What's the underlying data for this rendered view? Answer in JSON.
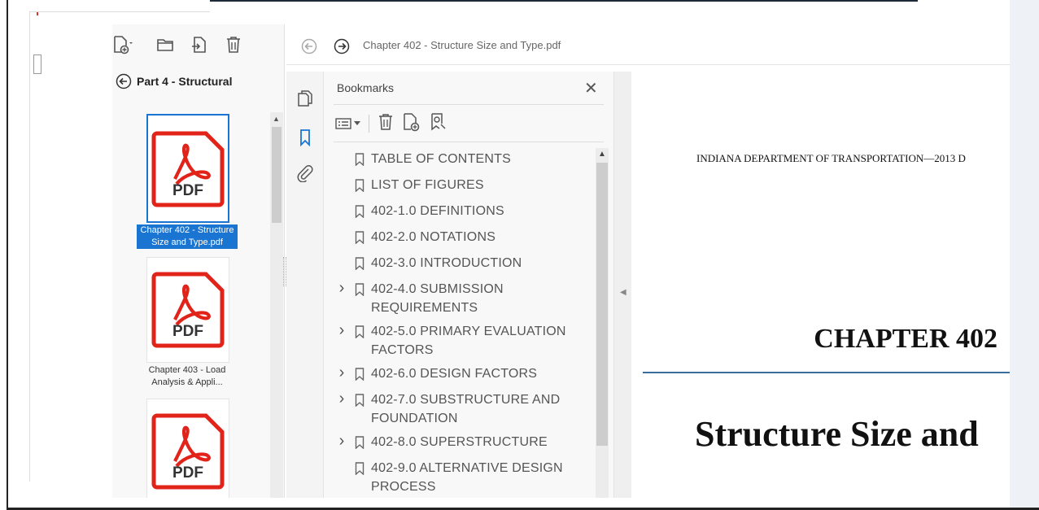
{
  "file_panel": {
    "back_label": "Part 4 - Structural",
    "files": [
      {
        "name": "Chapter 402 - Structure Size and Type.pdf",
        "icon_text": "PDF",
        "selected": true
      },
      {
        "name": "Chapter 403 - Load Analysis & Appli...",
        "icon_text": "PDF",
        "selected": false
      },
      {
        "name": "",
        "icon_text": "PDF",
        "selected": false
      }
    ]
  },
  "nav": {
    "document_title": "Chapter 402 - Structure Size and Type.pdf"
  },
  "bookmarks": {
    "title": "Bookmarks",
    "close_glyph": "✕",
    "items": [
      {
        "label": "TABLE OF CONTENTS",
        "expandable": false
      },
      {
        "label": "LIST OF FIGURES",
        "expandable": false
      },
      {
        "label": "402-1.0  DEFINITIONS",
        "expandable": false
      },
      {
        "label": "402-2.0  NOTATIONS",
        "expandable": false
      },
      {
        "label": "402-3.0  INTRODUCTION",
        "expandable": false
      },
      {
        "label": "402-4.0  SUBMISSION REQUIREMENTS",
        "expandable": true
      },
      {
        "label": "402-5.0  PRIMARY EVALUATION FACTORS",
        "expandable": true
      },
      {
        "label": "402-6.0  DESIGN FACTORS",
        "expandable": true
      },
      {
        "label": "402-7.0  SUBSTRUCTURE AND FOUNDATION",
        "expandable": true
      },
      {
        "label": "402-8.0  SUPERSTRUCTURE",
        "expandable": true
      },
      {
        "label": "402-9.0  ALTERNATIVE DESIGN PROCESS",
        "expandable": false
      }
    ]
  },
  "document": {
    "header": "INDIANA DEPARTMENT OF TRANSPORTATION—2013 D",
    "chapter": "CHAPTER 402",
    "title": "Structure Size and"
  },
  "colors": {
    "accent": "#1a75d2",
    "pdf_red": "#e2231a",
    "rule": "#3b6e9c"
  }
}
